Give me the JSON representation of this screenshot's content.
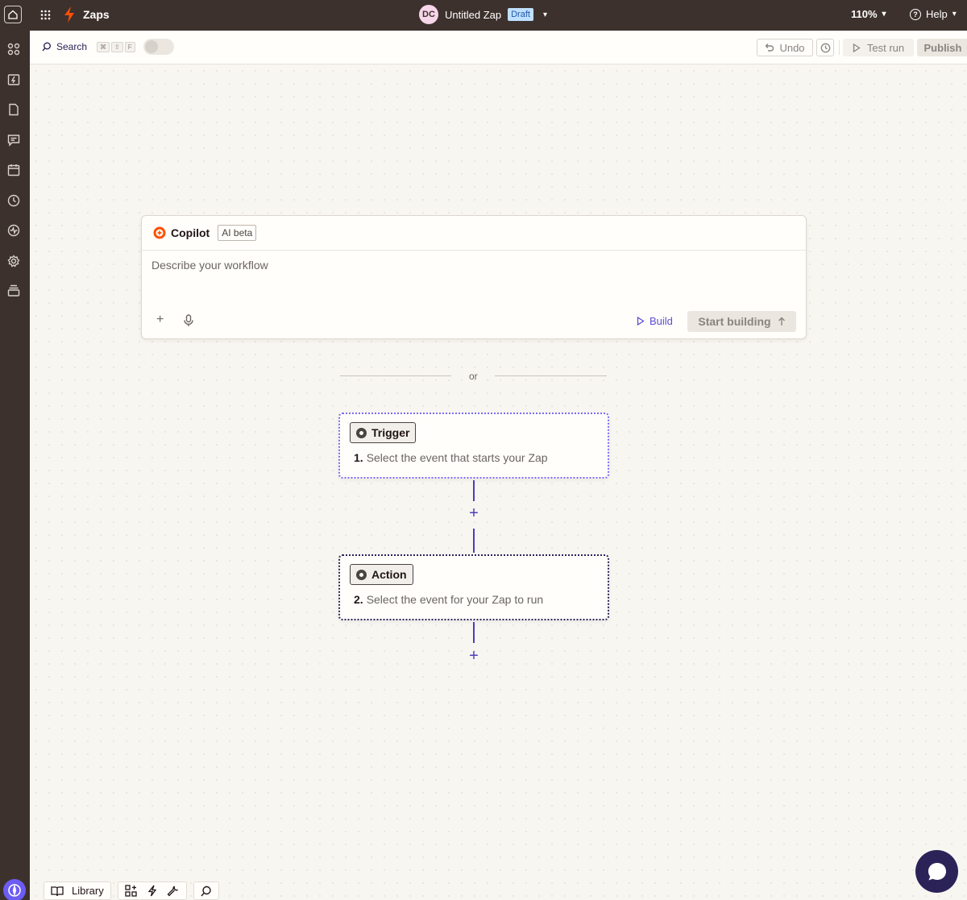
{
  "topbar": {
    "app_title": "Zaps",
    "avatar_initials": "DC",
    "zap_name": "Untitled Zap",
    "status_badge": "Draft",
    "zoom": "110%",
    "help_label": "Help"
  },
  "toolbar": {
    "search_label": "Search",
    "shortcut_keys": [
      "⌘",
      "⇧",
      "F"
    ],
    "undo_label": "Undo",
    "test_run_label": "Test run",
    "publish_label": "Publish"
  },
  "sidebar": {
    "icons": [
      "apps-icon",
      "zaps-icon",
      "tables-icon",
      "interfaces-icon",
      "calendar-icon",
      "history-icon",
      "activity-icon",
      "settings-icon",
      "layers-icon"
    ]
  },
  "copilot": {
    "title": "Copilot",
    "badge": "AI beta",
    "placeholder": "Describe your workflow",
    "build_label": "Build",
    "start_label": "Start building"
  },
  "divider": {
    "text": "or"
  },
  "steps": [
    {
      "chip": "Trigger",
      "number": "1.",
      "description": "Select the event that starts your Zap"
    },
    {
      "chip": "Action",
      "number": "2.",
      "description": "Select the event for your Zap to run"
    }
  ],
  "bottom_bar": {
    "library_label": "Library"
  },
  "colors": {
    "brand_orange": "#ff4f00",
    "accent_purple": "#5c4ed1",
    "dark_navy": "#2b2358",
    "chrome_brown": "#3d312d"
  }
}
